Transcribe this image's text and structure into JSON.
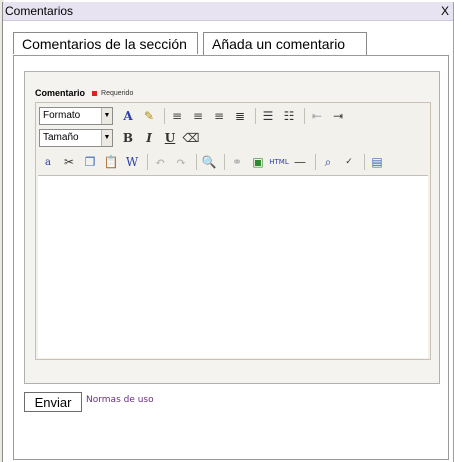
{
  "window": {
    "title": "Comentarios",
    "close_label": "X"
  },
  "tabs": [
    {
      "label": "Comentarios de la sección"
    },
    {
      "label": "Añada un comentario"
    }
  ],
  "form": {
    "field_label": "Comentario",
    "required_text": "Requerido",
    "submit_label": "Enviar",
    "terms_link": "Normas de uso"
  },
  "editor": {
    "format_select": "Formato",
    "size_select": "Tamaño",
    "row1_icons": [
      "text-color-icon",
      "highlight-icon",
      "align-left-icon",
      "align-center-icon",
      "align-right-icon",
      "align-justify-icon",
      "bullet-list-icon",
      "numbered-list-icon",
      "outdent-icon",
      "indent-icon"
    ],
    "row2_icons": [
      "bold-icon",
      "italic-icon",
      "underline-icon",
      "eraser-icon"
    ],
    "row3_icons": [
      "select-all-icon",
      "cut-icon",
      "copy-icon",
      "paste-icon",
      "paste-word-icon",
      "undo-icon",
      "redo-icon",
      "find-replace-icon",
      "link-icon",
      "image-icon",
      "html-icon",
      "horizontal-rule-icon",
      "binoculars-icon",
      "spellcheck-icon",
      "source-icon"
    ]
  }
}
